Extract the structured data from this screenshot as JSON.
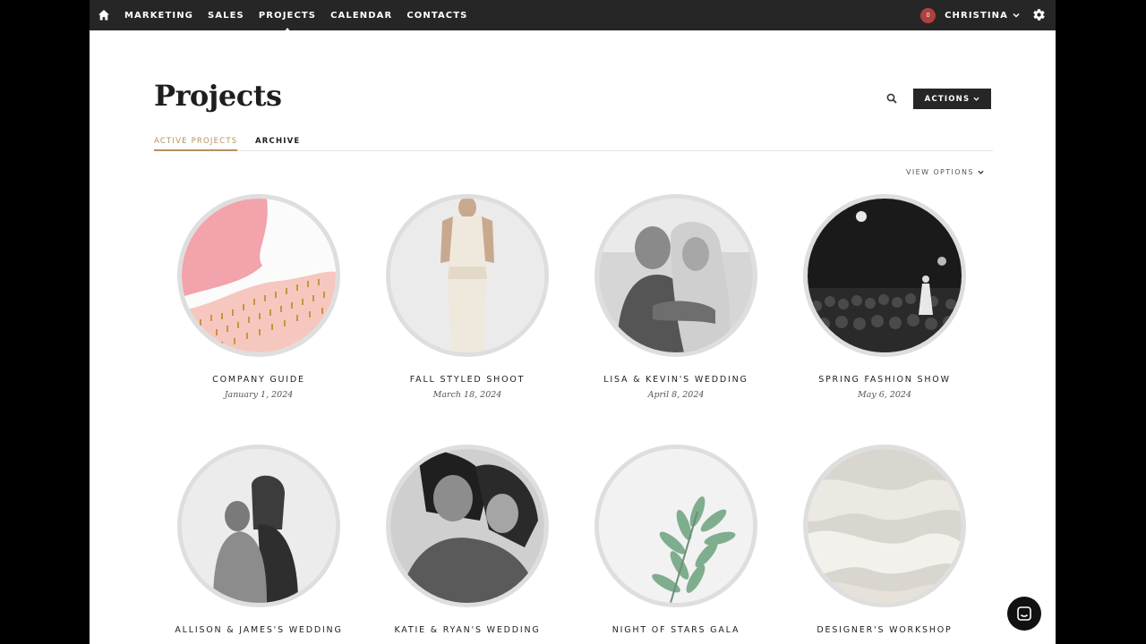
{
  "nav": {
    "items": [
      {
        "label": "MARKETING",
        "active": false
      },
      {
        "label": "SALES",
        "active": false
      },
      {
        "label": "PROJECTS",
        "active": true
      },
      {
        "label": "CALENDAR",
        "active": false
      },
      {
        "label": "CONTACTS",
        "active": false
      }
    ],
    "notification_count": "0",
    "user_name": "CHRISTINA"
  },
  "page": {
    "title": "Projects",
    "actions_label": "ACTIONS",
    "tabs": [
      {
        "label": "ACTIVE PROJECTS",
        "active": true
      },
      {
        "label": "ARCHIVE",
        "active": false
      }
    ],
    "view_options_label": "VIEW OPTIONS"
  },
  "projects": [
    {
      "title": "COMPANY GUIDE",
      "date": "January 1, 2024",
      "image": "abstract-pink-paint"
    },
    {
      "title": "FALL STYLED SHOOT",
      "date": "March 18, 2024",
      "image": "woman-cream-dress"
    },
    {
      "title": "LISA & KEVIN'S WEDDING",
      "date": "April 8, 2024",
      "image": "couple-embrace-bw"
    },
    {
      "title": "SPRING FASHION SHOW",
      "date": "May 6, 2024",
      "image": "runway-crowd-bw"
    },
    {
      "title": "ALLISON & JAMES'S WEDDING",
      "date": "",
      "image": "couple-hug-bw"
    },
    {
      "title": "KATIE & RYAN'S WEDDING",
      "date": "",
      "image": "couple-closeup-bw"
    },
    {
      "title": "NIGHT OF STARS GALA",
      "date": "",
      "image": "green-plant"
    },
    {
      "title": "DESIGNER'S WORKSHOP",
      "date": "",
      "image": "white-fabric"
    }
  ],
  "colors": {
    "nav_bg": "#262626",
    "accent": "#b39062",
    "badge": "#b0413e",
    "circle_border": "#dedede"
  }
}
